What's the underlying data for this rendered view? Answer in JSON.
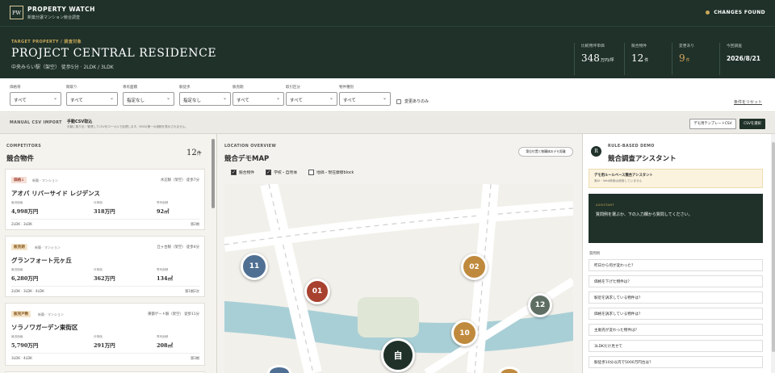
{
  "header": {
    "logo": "PW",
    "brand": "PROPERTY WATCH",
    "brand_sub": "新築分譲マンション競合調査",
    "changes": "CHANGES FOUND"
  },
  "hero": {
    "eyebrow": "TARGET PROPERTY / 調査対象",
    "title": "PROJECT CENTRAL RESIDENCE",
    "sub": "中央みらい駅（架空） 徒歩5分 · 2LDK / 3LDK",
    "stats": [
      {
        "label": "比較用坪単価",
        "value": "348",
        "unit": "万円/坪"
      },
      {
        "label": "競合物件",
        "value": "12",
        "unit": "件"
      },
      {
        "label": "変更あり",
        "value": "9",
        "unit": "件"
      },
      {
        "label": "今回調査",
        "value": "2026/8/21",
        "unit": ""
      }
    ]
  },
  "filters": {
    "items": [
      {
        "label": "価格帯",
        "value": "すべて"
      },
      {
        "label": "間取り",
        "value": "すべて"
      },
      {
        "label": "専有面積",
        "value": "指定なし"
      },
      {
        "label": "駅徒歩",
        "value": "指定なし"
      },
      {
        "label": "販売期",
        "value": "すべて"
      },
      {
        "label": "取引区分",
        "value": "すべて"
      },
      {
        "label": "物件種別",
        "value": "すべて"
      }
    ],
    "changed_only": "変更ありのみ",
    "reset": "条件をリセット"
  },
  "csv": {
    "label": "MANUAL CSV IMPORT",
    "title": "手動CSV取込",
    "sub": "手動に取り出・管理してCSVをローカルで処理します。MOD(第一の過程を表示されません。",
    "template_btn": "デモ用テンプレートCSV",
    "select_btn": "CSVを選択"
  },
  "competitors": {
    "label": "COMPETITORS",
    "title": "競合物件",
    "count": "12",
    "count_unit": "件",
    "cards": [
      {
        "badge": "価格↓",
        "kind": "新築 · マンション",
        "station": "水辺駅（架空） 徒歩7分",
        "name": "アオバ リバーサイド レジデンス",
        "m1_label": "最低価格",
        "m1": "4,998万円",
        "m2_label": "坪単価",
        "m2": "318万円",
        "m3_label": "専有面積",
        "m3": "92㎡",
        "layout": "2LDK · 3LDK",
        "floor": "第2期"
      },
      {
        "badge": "販売期",
        "kind": "新築 · マンション",
        "station": "丘ヶ台駅（架空） 徒歩4分",
        "name": "グランフォート元ヶ丘",
        "m1_label": "最低価格",
        "m1": "6,280万円",
        "m2_label": "坪単価",
        "m2": "362万円",
        "m3_label": "専有面積",
        "m3": "134㎡",
        "layout": "2LDK · 3LDK · 4LDK",
        "floor": "第1期2次"
      },
      {
        "badge": "販売戸数",
        "kind": "新築 · マンション",
        "station": "東都ゲート駅（架空） 徒歩11分",
        "name": "ソラノワガーデン東街区",
        "m1_label": "最低価格",
        "m1": "5,790万円",
        "m2_label": "坪単価",
        "m2": "291万円",
        "m3_label": "専有面積",
        "m3": "208㎡",
        "layout": "3LDK · 4LDK",
        "floor": "第3期"
      }
    ]
  },
  "map": {
    "label": "LOCATION OVERVIEW",
    "title": "競合デモMAP",
    "legend_btn": "第位付置と物購体のデモ距離",
    "options": [
      {
        "label": "競合物件",
        "checked": true
      },
      {
        "label": "学校・自然体",
        "checked": true
      },
      {
        "label": "地価・現在摩擦block",
        "checked": false
      }
    ],
    "self_pin": "自",
    "pins": [
      {
        "num": "11",
        "color": "#4f6f93"
      },
      {
        "num": "01",
        "color": "#a8412f"
      },
      {
        "num": "02",
        "color": "#c08a3e"
      },
      {
        "num": "12",
        "color": "#5f6e62"
      },
      {
        "num": "10",
        "color": "#c08a3e"
      }
    ]
  },
  "assistant": {
    "label": "RULE-BASED DEMO",
    "title": "競合調査アシスタント",
    "logo": "R",
    "notice_title": "デモ用ルールベース競合アシスタント",
    "notice_sub": "実AI・Web検索は使用していません",
    "bubble_label": "ASSISTANT",
    "bubble_text": "質問例を選ぶか、下の入力欄から質問してください。",
    "q_label": "質問例",
    "questions": [
      "昨日から何が変わった？",
      "価格を下げた物件は？",
      "駅近を訴求している物件は？",
      "価格を訴求している物件は？",
      "主販売が変わった物件は？",
      "3LDKだけ見せて",
      "駅徒歩10分以内で5000万円台は？"
    ]
  },
  "colors": {
    "dark_green": "#1f3129",
    "gold": "#c9a85a",
    "bg": "#f3f2ee"
  }
}
